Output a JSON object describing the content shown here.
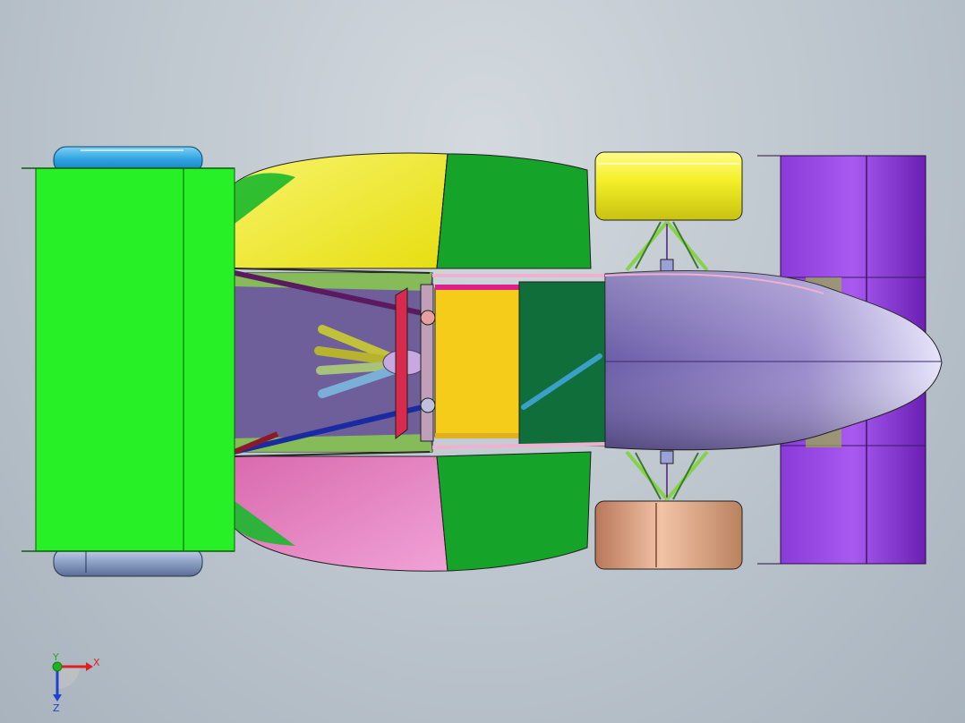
{
  "view_triad": {
    "x_label": "X",
    "y_label": "Y",
    "z_label": "Z"
  },
  "colors": {
    "background_center": "#d3d9de",
    "background_edge": "#a8b3bd",
    "rear_wing": "#22ee22",
    "sidepod_left": "#f2ee1a",
    "sidepod_right": "#e67cc2",
    "body_green": "#16a82a",
    "nose": "#7c6fb4",
    "front_wing": "#7a2fc2",
    "wheel_front_top": "#f2ee2a",
    "wheel_front_bottom": "#d9a07f",
    "wheel_rear_top": "#3aa8e0",
    "wheel_rear_bottom": "#8c9fc2",
    "cockpit_seat": "#f5c51c",
    "axis_x": "#e02020",
    "axis_y": "#20b020",
    "axis_z": "#2040d0"
  }
}
